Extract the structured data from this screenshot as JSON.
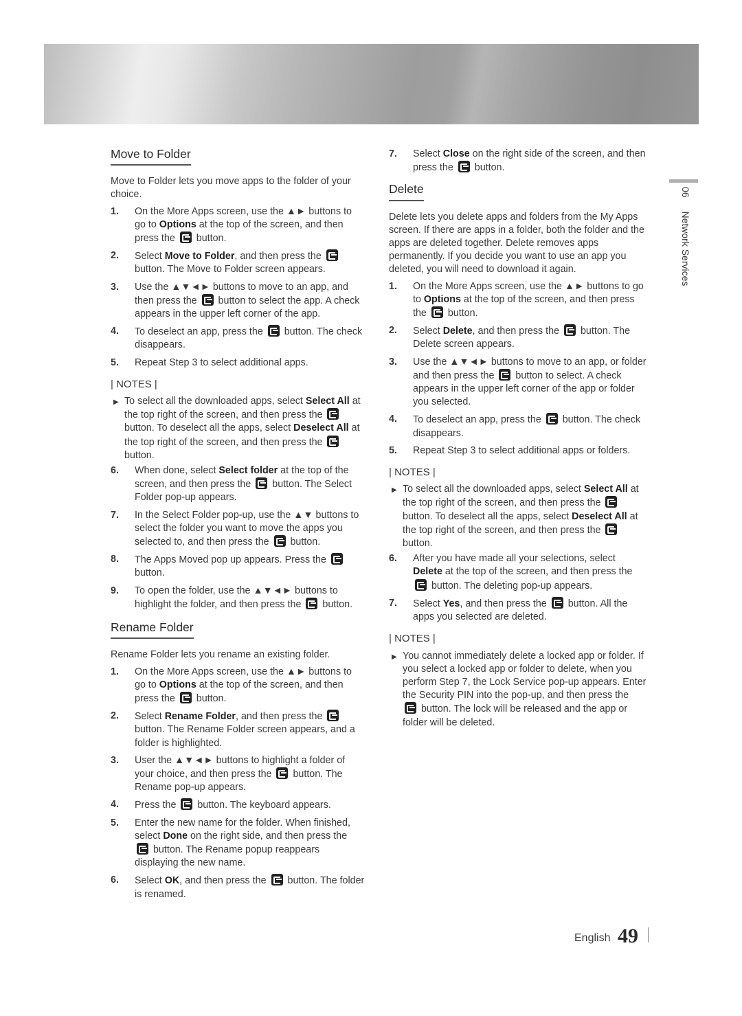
{
  "side_tab": {
    "chapter": "06",
    "title": "Network Services"
  },
  "footer": {
    "language": "English",
    "page_number": "49"
  },
  "move_to_folder": {
    "heading": "Move to Folder",
    "intro": "Move to Folder lets you move apps to the folder of your choice.",
    "steps": [
      {
        "num": "1.",
        "html": "On the More Apps screen, use the ▲► buttons to go to <b>Options</b> at the top of the screen, and then press the [E] button."
      },
      {
        "num": "2.",
        "html": "Select <b>Move to Folder</b>, and then press the [E] button. The Move to Folder screen appears."
      },
      {
        "num": "3.",
        "html": "Use the ▲▼◄► buttons to move to an app, and then press the [E] button to select the app. A check appears in the upper left corner of the app."
      },
      {
        "num": "4.",
        "html": "To deselect an app, press the [E] button. The check disappears."
      },
      {
        "num": "5.",
        "html": "Repeat Step 3 to select additional apps."
      }
    ],
    "notes_label": "| NOTES |",
    "notes": [
      {
        "html": "To select all the downloaded apps, select <b>Select All</b> at the top right of the screen, and then press the [E] button. To deselect all the apps, select <b>Deselect All</b> at the top right of the screen, and then press the [E] button."
      }
    ],
    "steps_after_notes": [
      {
        "num": "6.",
        "html": "When done, select <b>Select folder</b> at the top of the screen, and then press the [E] button. The Select Folder pop-up appears."
      },
      {
        "num": "7.",
        "html": "In the Select Folder pop-up, use the ▲▼ buttons to select the folder you want to move the apps you selected to, and then press the [E] button."
      },
      {
        "num": "8.",
        "html": "The Apps Moved pop up appears. Press the [E] button."
      },
      {
        "num": "9.",
        "html": "To open the folder, use the ▲▼◄► buttons to highlight the folder, and then press the [E] button."
      }
    ]
  },
  "rename_folder": {
    "heading": "Rename Folder",
    "intro": "Rename Folder lets you rename an existing folder.",
    "steps": [
      {
        "num": "1.",
        "html": "On the More Apps screen, use the ▲► buttons to go to <b>Options</b> at the top of the screen, and then press the [E] button."
      },
      {
        "num": "2.",
        "html": "Select <b>Rename Folder</b>, and then press the [E] button. The Rename Folder screen appears, and a folder is highlighted."
      },
      {
        "num": "3.",
        "html": "User the ▲▼◄► buttons to highlight a folder of your choice, and then press the [E] button. The Rename pop-up appears."
      },
      {
        "num": "4.",
        "html": "Press the [E] button. The keyboard appears."
      },
      {
        "num": "5.",
        "html": "Enter the new name for the folder. When finished, select <b>Done</b> on the right side, and then press the [E] button. The Rename popup reappears displaying the new name."
      },
      {
        "num": "6.",
        "html": "Select <b>OK</b>, and then press the [E] button. The folder is renamed."
      }
    ]
  },
  "rename_continued": {
    "steps": [
      {
        "num": "7.",
        "html": "Select <b>Close</b> on the right side of the screen, and then press the [E] button."
      }
    ]
  },
  "delete": {
    "heading": "Delete",
    "intro": "Delete lets you delete apps and folders from the My Apps screen. If there are apps in a folder, both the folder and the apps are deleted together. Delete removes apps permanently. If you decide you want to use an app you deleted, you will need to download it again.",
    "steps": [
      {
        "num": "1.",
        "html": "On the More Apps screen, use the ▲► buttons to go to <b>Options</b> at the top of the screen, and then press the [E] button."
      },
      {
        "num": "2.",
        "html": "Select <b>Delete</b>, and then press the [E] button. The Delete screen appears."
      },
      {
        "num": "3.",
        "html": "Use the ▲▼◄► buttons to move to an app, or folder and then press the [E] button to select. A check appears in the upper left corner of the app or folder you selected."
      },
      {
        "num": "4.",
        "html": "To deselect an app, press the [E] button. The check disappears."
      },
      {
        "num": "5.",
        "html": "Repeat Step 3 to select additional apps or folders."
      }
    ],
    "notes_label": "| NOTES |",
    "notes": [
      {
        "html": "To select all the downloaded apps, select <b>Select All</b> at the top right of the screen, and then press the [E] button. To deselect all the apps, select <b>Deselect All</b> at the top right of the screen, and then press the [E] button."
      }
    ],
    "steps_after_notes": [
      {
        "num": "6.",
        "html": "After you have made all your selections, select <b>Delete</b> at the top of the screen, and then press the [E] button. The deleting pop-up appears."
      },
      {
        "num": "7.",
        "html": "Select <b>Yes</b>, and then press the [E] button. All the apps you selected are deleted."
      }
    ],
    "notes2_label": "| NOTES |",
    "notes2": [
      {
        "html": "You cannot immediately delete a locked app or folder. If you select a locked app or folder to delete, when you perform Step 7, the Lock Service pop-up appears. Enter the Security PIN into the pop-up, and then press the [E] button. The lock will be released and the app or folder will be deleted."
      }
    ]
  },
  "icons": {
    "enter_button": "enter-button-icon",
    "note_bullet": "triangle-right-icon"
  }
}
